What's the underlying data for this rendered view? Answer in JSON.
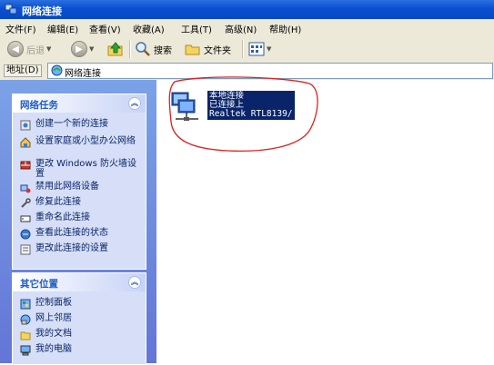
{
  "window": {
    "title": "网络连接"
  },
  "menu": [
    "文件(F)",
    "编辑(E)",
    "查看(V)",
    "收藏(A)",
    "工具(T)",
    "高级(N)",
    "帮助(H)"
  ],
  "toolbar": {
    "back": "后退",
    "search": "搜索",
    "folders": "文件夹"
  },
  "address": {
    "label": "地址(D)",
    "value": "网络连接"
  },
  "tasks_panel": {
    "title": "网络任务",
    "items": [
      {
        "icon": "new-connection-icon",
        "label": "创建一个新的连接"
      },
      {
        "icon": "home-network-icon",
        "label": "设置家庭或小型办公网络"
      },
      {
        "icon": "firewall-icon",
        "label": "更改 Windows 防火墙设置"
      },
      {
        "icon": "disable-device-icon",
        "label": "禁用此网络设备"
      },
      {
        "icon": "repair-icon",
        "label": "修复此连接"
      },
      {
        "icon": "rename-icon",
        "label": "重命名此连接"
      },
      {
        "icon": "status-icon",
        "label": "查看此连接的状态"
      },
      {
        "icon": "settings-icon",
        "label": "更改此连接的设置"
      }
    ]
  },
  "places_panel": {
    "title": "其它位置",
    "items": [
      {
        "icon": "control-panel-icon",
        "label": "控制面板"
      },
      {
        "icon": "network-places-icon",
        "label": "网上邻居"
      },
      {
        "icon": "my-documents-icon",
        "label": "我的文档"
      },
      {
        "icon": "my-computer-icon",
        "label": "我的电脑"
      }
    ]
  },
  "connection": {
    "name": "本地连接",
    "status": "已连接上",
    "device": "Realtek RTL8139/"
  },
  "colors": {
    "titlebar": "#0a4fd0",
    "selection": "#0a246a",
    "annotation": "#e02020",
    "pane": "#6f8be0"
  }
}
